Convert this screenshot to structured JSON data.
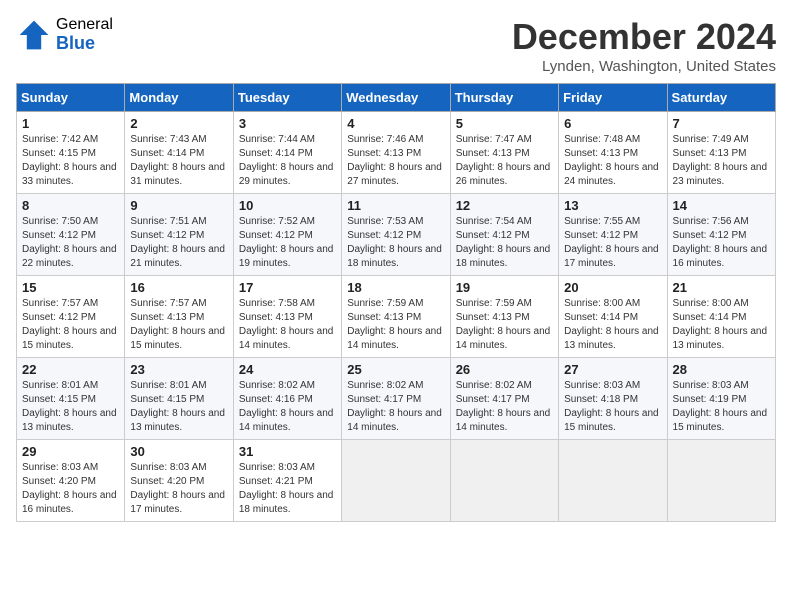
{
  "header": {
    "logo_general": "General",
    "logo_blue": "Blue",
    "title": "December 2024",
    "location": "Lynden, Washington, United States"
  },
  "days_of_week": [
    "Sunday",
    "Monday",
    "Tuesday",
    "Wednesday",
    "Thursday",
    "Friday",
    "Saturday"
  ],
  "weeks": [
    [
      {
        "day": "1",
        "sunrise": "7:42 AM",
        "sunset": "4:15 PM",
        "daylight": "8 hours and 33 minutes."
      },
      {
        "day": "2",
        "sunrise": "7:43 AM",
        "sunset": "4:14 PM",
        "daylight": "8 hours and 31 minutes."
      },
      {
        "day": "3",
        "sunrise": "7:44 AM",
        "sunset": "4:14 PM",
        "daylight": "8 hours and 29 minutes."
      },
      {
        "day": "4",
        "sunrise": "7:46 AM",
        "sunset": "4:13 PM",
        "daylight": "8 hours and 27 minutes."
      },
      {
        "day": "5",
        "sunrise": "7:47 AM",
        "sunset": "4:13 PM",
        "daylight": "8 hours and 26 minutes."
      },
      {
        "day": "6",
        "sunrise": "7:48 AM",
        "sunset": "4:13 PM",
        "daylight": "8 hours and 24 minutes."
      },
      {
        "day": "7",
        "sunrise": "7:49 AM",
        "sunset": "4:13 PM",
        "daylight": "8 hours and 23 minutes."
      }
    ],
    [
      {
        "day": "8",
        "sunrise": "7:50 AM",
        "sunset": "4:12 PM",
        "daylight": "8 hours and 22 minutes."
      },
      {
        "day": "9",
        "sunrise": "7:51 AM",
        "sunset": "4:12 PM",
        "daylight": "8 hours and 21 minutes."
      },
      {
        "day": "10",
        "sunrise": "7:52 AM",
        "sunset": "4:12 PM",
        "daylight": "8 hours and 19 minutes."
      },
      {
        "day": "11",
        "sunrise": "7:53 AM",
        "sunset": "4:12 PM",
        "daylight": "8 hours and 18 minutes."
      },
      {
        "day": "12",
        "sunrise": "7:54 AM",
        "sunset": "4:12 PM",
        "daylight": "8 hours and 18 minutes."
      },
      {
        "day": "13",
        "sunrise": "7:55 AM",
        "sunset": "4:12 PM",
        "daylight": "8 hours and 17 minutes."
      },
      {
        "day": "14",
        "sunrise": "7:56 AM",
        "sunset": "4:12 PM",
        "daylight": "8 hours and 16 minutes."
      }
    ],
    [
      {
        "day": "15",
        "sunrise": "7:57 AM",
        "sunset": "4:12 PM",
        "daylight": "8 hours and 15 minutes."
      },
      {
        "day": "16",
        "sunrise": "7:57 AM",
        "sunset": "4:13 PM",
        "daylight": "8 hours and 15 minutes."
      },
      {
        "day": "17",
        "sunrise": "7:58 AM",
        "sunset": "4:13 PM",
        "daylight": "8 hours and 14 minutes."
      },
      {
        "day": "18",
        "sunrise": "7:59 AM",
        "sunset": "4:13 PM",
        "daylight": "8 hours and 14 minutes."
      },
      {
        "day": "19",
        "sunrise": "7:59 AM",
        "sunset": "4:13 PM",
        "daylight": "8 hours and 14 minutes."
      },
      {
        "day": "20",
        "sunrise": "8:00 AM",
        "sunset": "4:14 PM",
        "daylight": "8 hours and 13 minutes."
      },
      {
        "day": "21",
        "sunrise": "8:00 AM",
        "sunset": "4:14 PM",
        "daylight": "8 hours and 13 minutes."
      }
    ],
    [
      {
        "day": "22",
        "sunrise": "8:01 AM",
        "sunset": "4:15 PM",
        "daylight": "8 hours and 13 minutes."
      },
      {
        "day": "23",
        "sunrise": "8:01 AM",
        "sunset": "4:15 PM",
        "daylight": "8 hours and 13 minutes."
      },
      {
        "day": "24",
        "sunrise": "8:02 AM",
        "sunset": "4:16 PM",
        "daylight": "8 hours and 14 minutes."
      },
      {
        "day": "25",
        "sunrise": "8:02 AM",
        "sunset": "4:17 PM",
        "daylight": "8 hours and 14 minutes."
      },
      {
        "day": "26",
        "sunrise": "8:02 AM",
        "sunset": "4:17 PM",
        "daylight": "8 hours and 14 minutes."
      },
      {
        "day": "27",
        "sunrise": "8:03 AM",
        "sunset": "4:18 PM",
        "daylight": "8 hours and 15 minutes."
      },
      {
        "day": "28",
        "sunrise": "8:03 AM",
        "sunset": "4:19 PM",
        "daylight": "8 hours and 15 minutes."
      }
    ],
    [
      {
        "day": "29",
        "sunrise": "8:03 AM",
        "sunset": "4:20 PM",
        "daylight": "8 hours and 16 minutes."
      },
      {
        "day": "30",
        "sunrise": "8:03 AM",
        "sunset": "4:20 PM",
        "daylight": "8 hours and 17 minutes."
      },
      {
        "day": "31",
        "sunrise": "8:03 AM",
        "sunset": "4:21 PM",
        "daylight": "8 hours and 18 minutes."
      },
      null,
      null,
      null,
      null
    ]
  ]
}
